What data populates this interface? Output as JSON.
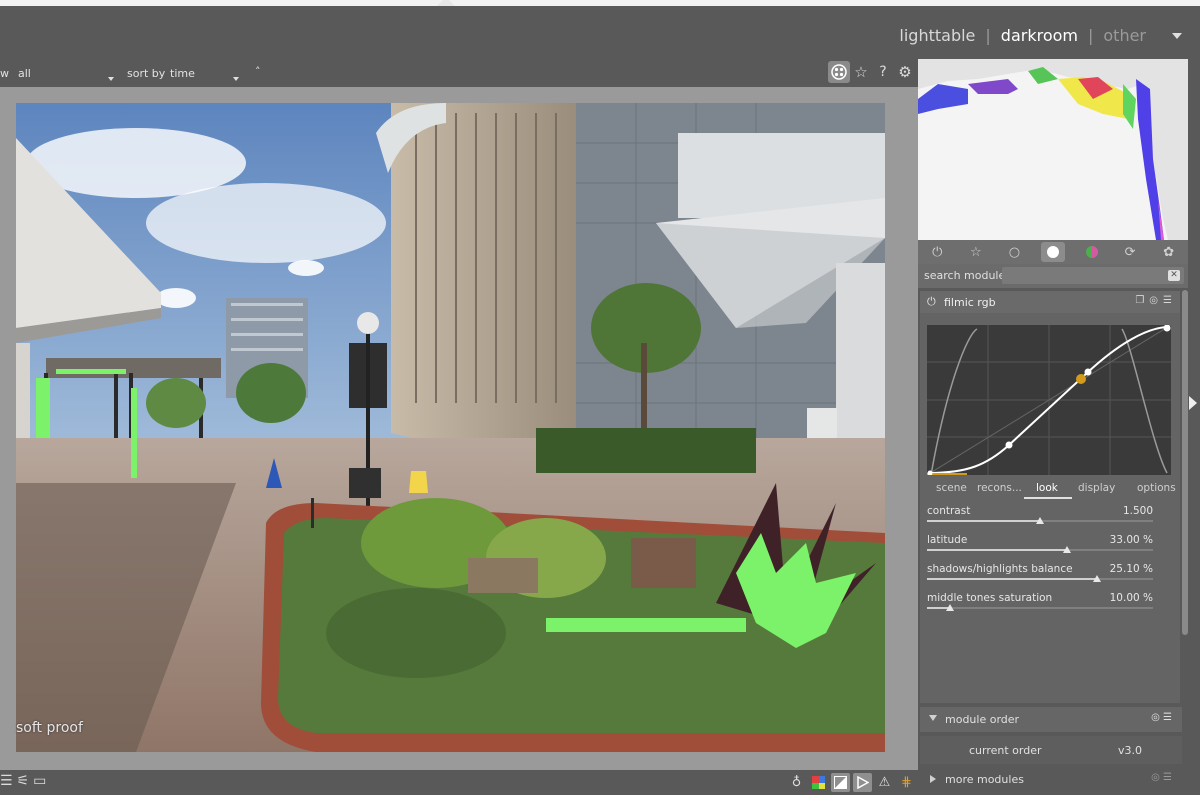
{
  "header": {
    "views": {
      "lighttable": "lighttable",
      "darkroom": "darkroom",
      "other": "other",
      "separator": "|"
    }
  },
  "filterbar": {
    "view_fragment": "w",
    "filter_value": "all",
    "sort_label": "sort by",
    "sort_value": "time",
    "sort_dir": "˄"
  },
  "toolbar_icons": [
    "grid-icon",
    "star-icon",
    "help-icon",
    "gear-icon"
  ],
  "image": {
    "overlay_label": "soft proof"
  },
  "module_groups": [
    "power-icon",
    "favorites-icon",
    "circle-icon",
    "tone-icon",
    "color-icon",
    "correct-icon",
    "effect-icon"
  ],
  "search": {
    "label": "search module",
    "placeholder": ""
  },
  "filmic": {
    "title": "filmic rgb",
    "tabs": [
      "scene",
      "recons...",
      "look",
      "display",
      "options"
    ],
    "active_tab": "look",
    "sliders": [
      {
        "label": "contrast",
        "value": "1.500",
        "fraction": 0.5
      },
      {
        "label": "latitude",
        "value": "33.00 %",
        "fraction": 0.62
      },
      {
        "label": "shadows/highlights balance",
        "value": "25.10 %",
        "fraction": 0.75
      },
      {
        "label": "middle tones saturation",
        "value": "10.00 %",
        "fraction": 0.1
      }
    ]
  },
  "module_order": {
    "title": "module order",
    "current_label": "current order",
    "current_value": "v3.0"
  },
  "more_modules": {
    "title": "more modules"
  },
  "colors": {
    "panel": "#595959",
    "accent_dot": "#d49a1a",
    "gamut_green": "#7cf26a"
  }
}
